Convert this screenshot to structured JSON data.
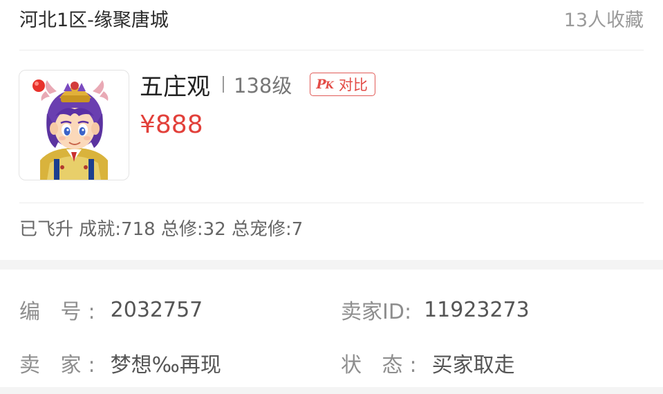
{
  "header": {
    "server_name": "河北1区-缘聚唐城",
    "favorites": "13人收藏"
  },
  "role": {
    "school": "五庄观",
    "level": "138级",
    "pk_icon": "P",
    "pk_icon_k": "K",
    "pk_label": "对比",
    "price": "¥888",
    "stats": "已飞升 成就:718 总修:32 总宠修:7"
  },
  "details": {
    "id_label": "编 号:",
    "id_value": "2032757",
    "seller_id_label": "卖家ID:",
    "seller_id_value": "11923273",
    "seller_label": "卖 家:",
    "seller_value": "梦想‰再现",
    "status_label": "状 态:",
    "status_value": "买家取走"
  },
  "colors": {
    "price": "#e2403a",
    "pk_accent": "#e15b57",
    "section_gap": "#f4f4f4"
  }
}
